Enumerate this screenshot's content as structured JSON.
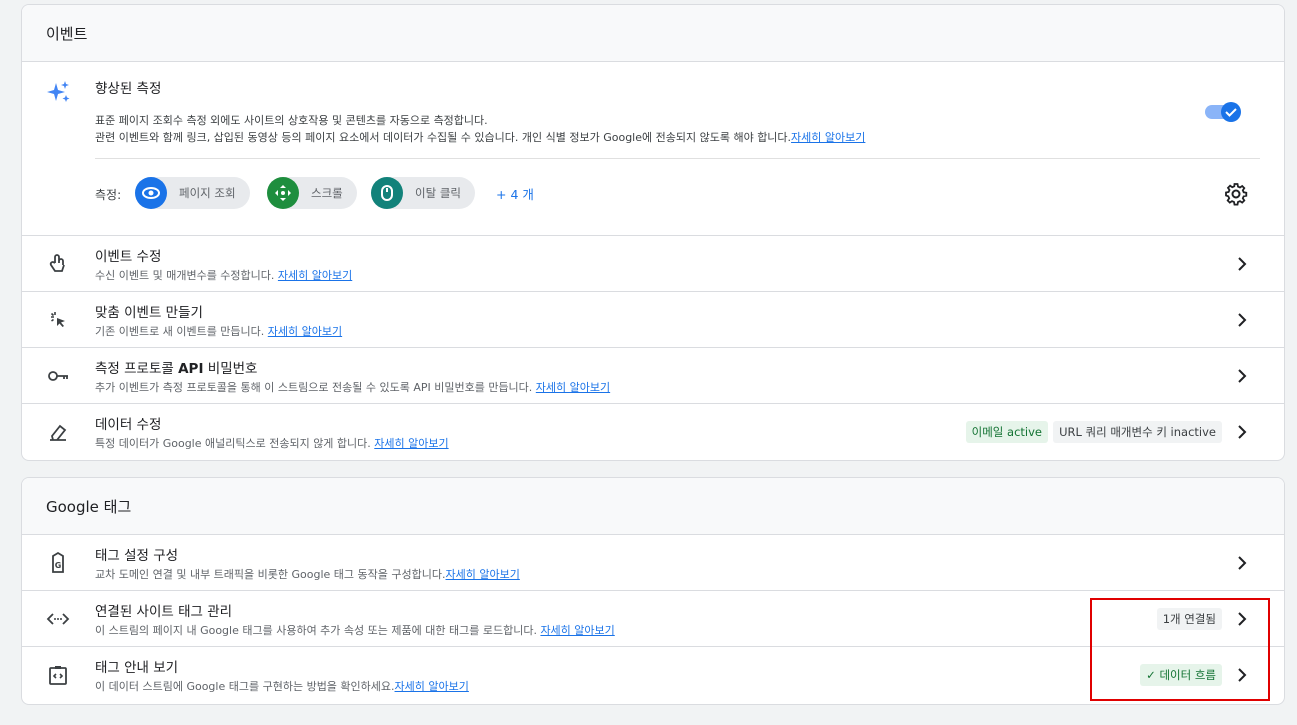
{
  "events": {
    "header": "이벤트",
    "enhanced": {
      "title": "향상된 측정",
      "desc_line1": "표준 페이지 조회수 측정 외에도 사이트의 상호작용 및 콘텐츠를 자동으로 측정합니다.",
      "desc_line2": "관련 이벤트와 함께 링크, 삽입된 동영상 등의 페이지 요소에서 데이터가 수집될 수 있습니다. 개인 식별 정보가 Google에 전송되지 않도록 해야 합니다.",
      "learn_more": "자세히 알아보기",
      "toggle_on": true,
      "measure_label": "측정:",
      "pills": [
        {
          "label": "페이지 조회",
          "icon": "eye-icon",
          "color": "#1a73e8"
        },
        {
          "label": "스크롤",
          "icon": "scroll-icon",
          "color": "#1e8e3e"
        },
        {
          "label": "이탈 클릭",
          "icon": "mouse-icon",
          "color": "#12827a"
        }
      ],
      "more": "+ 4 개"
    },
    "rows": [
      {
        "title": "이벤트 수정",
        "desc": "수신 이벤트 및 매개변수를 수정합니다. ",
        "link": "자세히 알아보기"
      },
      {
        "title": "맞춤 이벤트 만들기",
        "desc": "기존 이벤트로 새 이벤트를 만듭니다. ",
        "link": "자세히 알아보기"
      },
      {
        "title_a": "측정 프로토콜 ",
        "title_b": "API",
        "title_c": " 비밀번호",
        "desc": "추가 이벤트가 측정 프로토콜을 통해 이 스트림으로 전송될 수 있도록 API 비밀번호를 만듭니다. ",
        "link": "자세히 알아보기"
      },
      {
        "title": "데이터 수정",
        "desc": "특정 데이터가 Google 애널리틱스로 전송되지 않게 합니다. ",
        "link": "자세히 알아보기",
        "chip1": "이메일 active",
        "chip2": "URL 쿼리 매개변수 키 inactive"
      }
    ]
  },
  "google_tag": {
    "header": "Google 태그",
    "rows": [
      {
        "title": "태그 설정 구성",
        "desc": "교차 도메인 연결 및 내부 트래픽을 비롯한 Google 태그 동작을 구성합니다.",
        "link": "자세히 알아보기"
      },
      {
        "title": "연결된 사이트 태그 관리",
        "desc": "이 스트림의 페이지 내 Google 태그를 사용하여 추가 속성 또는 제품에 대한 태그를 로드합니다. ",
        "link": "자세히 알아보기",
        "chip": "1개 연결됨"
      },
      {
        "title": "태그 안내 보기",
        "desc": "이 데이터 스트림에 Google 태그를 구현하는 방법을 확인하세요.",
        "link": "자세히 알아보기",
        "chip": "데이터 흐름"
      }
    ]
  },
  "colors": {
    "accent": "#1a73e8",
    "highlight": "#e00000"
  }
}
